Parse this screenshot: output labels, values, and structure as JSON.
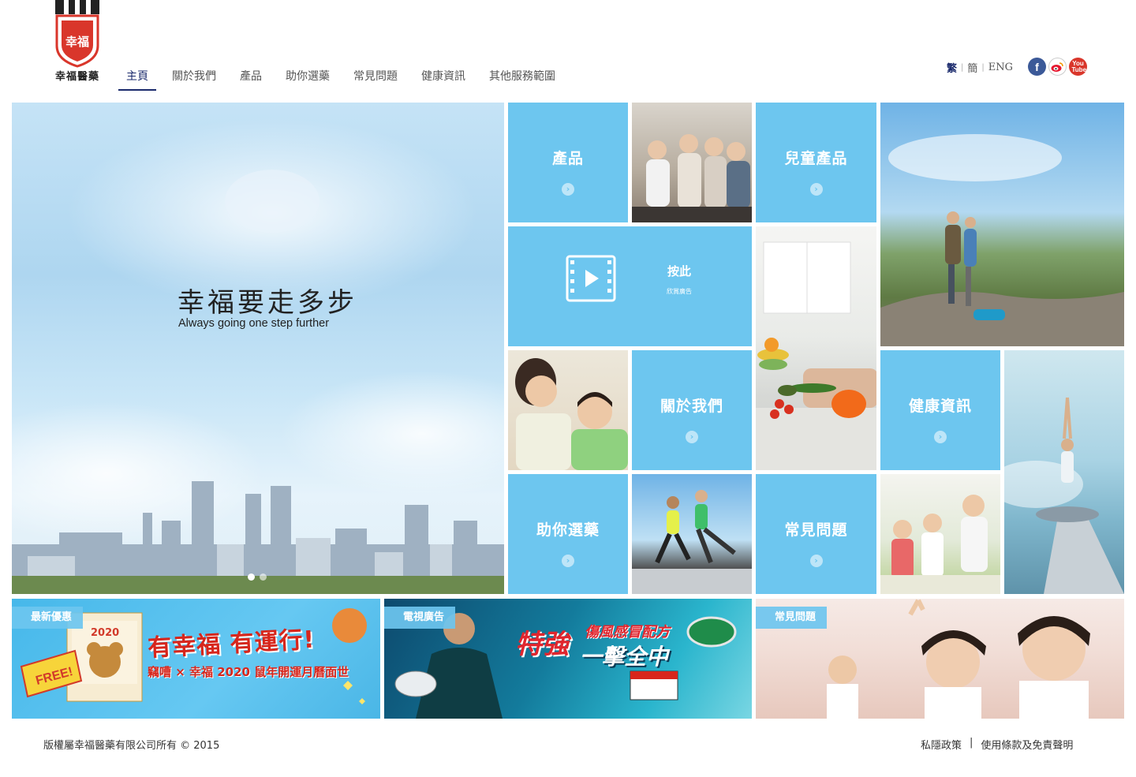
{
  "brand": {
    "name": "幸福醫藥",
    "logo_mark": "幸福"
  },
  "nav": [
    {
      "label": "主頁",
      "active": true
    },
    {
      "label": "關於我們"
    },
    {
      "label": "產品"
    },
    {
      "label": "助你選藥"
    },
    {
      "label": "常見問題"
    },
    {
      "label": "健康資訊"
    },
    {
      "label": "其他服務範圍"
    }
  ],
  "languages": [
    "繁",
    "簡",
    "ENG"
  ],
  "current_language": "繁",
  "social": {
    "facebook": "f",
    "weibo": "weibo-icon",
    "youtube": "You Tube"
  },
  "hero": {
    "slogan_cn": "幸福要走多步",
    "slogan_en": "Always going one step further",
    "slides": 2,
    "active_slide": 1
  },
  "tiles": {
    "products": "產品",
    "kids_products": "兒童產品",
    "video_title": "按此",
    "video_sub": "欣賞廣告",
    "about": "關於我們",
    "health": "健康資訊",
    "choose": "助你選藥",
    "faq": "常見問題"
  },
  "banners": {
    "promo": {
      "tag": "最新優惠",
      "headline": "有幸福 有運行!",
      "sub": "竊嘈 × 幸福 2020 鼠年開運月曆面世",
      "free": "FREE!",
      "calendar_year": "2020"
    },
    "tv_ad": {
      "tag": "電視廣告",
      "headline1": "特強",
      "headline2": "傷風感冒配方",
      "headline3": "一擊全中"
    },
    "faq": {
      "tag": "常見問題"
    }
  },
  "footer": {
    "copyright": "版權屬幸福醫藥有限公司所有 © 2015",
    "privacy": "私隱政策",
    "separator": "|",
    "terms": "使用條款及免責聲明"
  },
  "colors": {
    "tile_blue": "#6dc6ef",
    "nav_active": "#1a2a6c",
    "logo_red": "#d9362b"
  }
}
